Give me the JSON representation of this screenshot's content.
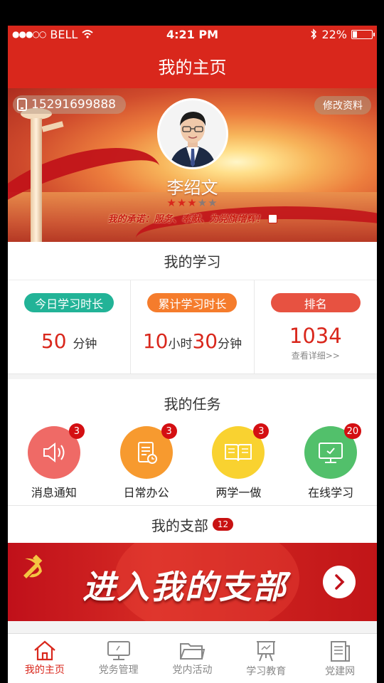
{
  "status_bar": {
    "signal": "●●●○○",
    "carrier": "BELL",
    "time": "4:21 PM",
    "battery_pct": "22%",
    "battery_level": 0.22
  },
  "header": {
    "title": "我的主页"
  },
  "profile": {
    "phone": "15291699888",
    "edit_label": "修改资料",
    "name": "李绍文",
    "stars_filled": 3,
    "stars_total": 5,
    "pledge": "我的承诺：服务、奉献、为党旗增辉！"
  },
  "study": {
    "title": "我的学习",
    "today_label": "今日学习时长",
    "today_minutes": "50",
    "minute_unit": "分钟",
    "total_label": "累计学习时长",
    "total_hours": "10",
    "hour_unit": "小时",
    "total_minutes": "30",
    "rank_label": "排名",
    "rank_value": "1034",
    "rank_detail": "查看详细>>"
  },
  "tasks": {
    "title": "我的任务",
    "items": [
      {
        "label": "消息通知",
        "count": "3",
        "icon": "speaker-icon"
      },
      {
        "label": "日常办公",
        "count": "3",
        "icon": "document-clock-icon"
      },
      {
        "label": "两学一做",
        "count": "3",
        "icon": "open-book-icon"
      },
      {
        "label": "在线学习",
        "count": "20",
        "icon": "monitor-icon"
      }
    ]
  },
  "branch": {
    "title": "我的支部",
    "count": "12",
    "banner_text": "进入我的支部"
  },
  "tabbar": {
    "items": [
      {
        "label": "我的主页",
        "icon": "home-icon",
        "active": true
      },
      {
        "label": "党务管理",
        "icon": "monitor-icon",
        "active": false
      },
      {
        "label": "党内活动",
        "icon": "folder-icon",
        "active": false
      },
      {
        "label": "学习教育",
        "icon": "easel-icon",
        "active": false
      },
      {
        "label": "党建网",
        "icon": "news-icon",
        "active": false
      }
    ]
  },
  "colors": {
    "primary": "#d9271c",
    "teal": "#22b397",
    "orange": "#f57c2c",
    "rank_red": "#e75241"
  }
}
